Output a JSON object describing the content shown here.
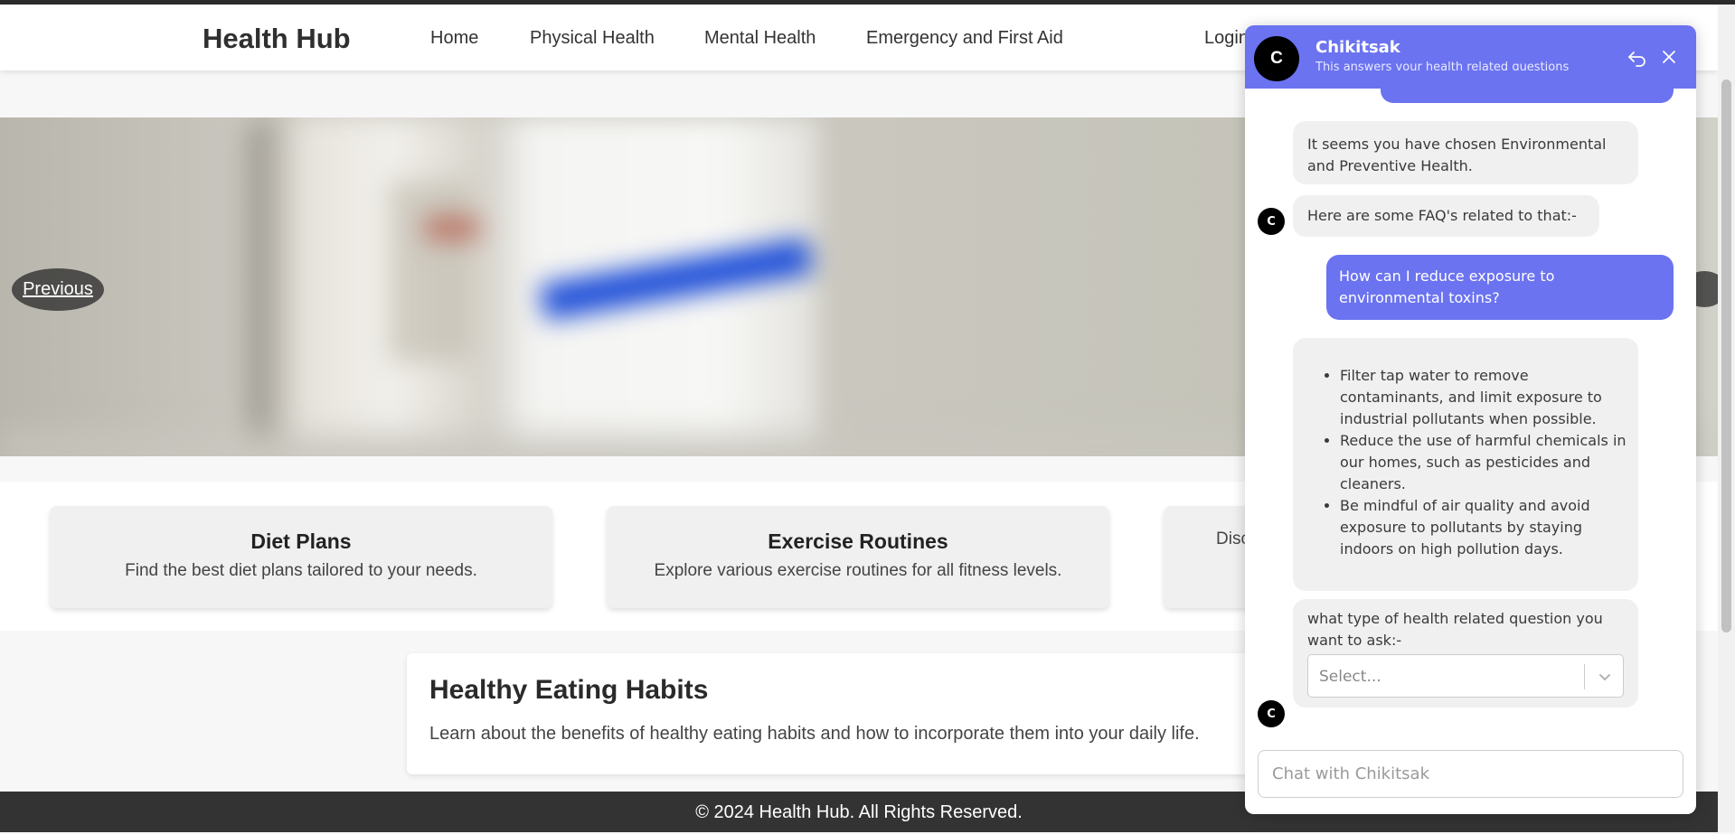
{
  "app": {
    "brand": "Health Hub"
  },
  "nav": {
    "items": [
      {
        "label": "Home"
      },
      {
        "label": "Physical Health"
      },
      {
        "label": "Mental Health"
      },
      {
        "label": "Emergency and First Aid"
      },
      {
        "label": "Login"
      }
    ]
  },
  "carousel": {
    "prev_label": "Previous"
  },
  "cards": [
    {
      "title": "Diet Plans",
      "description": "Find the best diet plans tailored to your needs."
    },
    {
      "title": "Exercise Routines",
      "description": "Explore various exercise routines for all fitness levels."
    },
    {
      "title": "",
      "description": "Disc"
    }
  ],
  "article": {
    "title": "Healthy Eating Habits",
    "body": "Learn about the benefits of healthy eating habits and how to incorporate them into your daily life."
  },
  "footer": {
    "text": "© 2024 Health Hub. All Rights Reserved."
  },
  "chat": {
    "avatar_letter": "C",
    "title": "Chikitsak",
    "subtitle": "This answers your health related questions",
    "header_color": "#6b73f0",
    "messages": [
      {
        "from": "bot",
        "text": "It seems you have chosen Environmental and Preventive Health."
      },
      {
        "from": "bot",
        "text": "Here are some FAQ's related to that:-"
      },
      {
        "from": "user",
        "text": "How can I reduce exposure to environmental toxins?"
      },
      {
        "from": "bot",
        "list": [
          "Filter tap water to remove contaminants, and limit exposure to industrial pollutants when possible.",
          "Reduce the use of harmful chemicals in our homes, such as pesticides and cleaners.",
          "Be mindful of air quality and avoid exposure to pollutants by staying indoors on high pollution days."
        ]
      },
      {
        "from": "bot",
        "text": "what type of health related question you want to ask:-"
      }
    ],
    "select": {
      "placeholder": "Select..."
    },
    "input": {
      "placeholder": "Chat with Chikitsak"
    }
  },
  "icons": {
    "restart": "restart-icon",
    "close": "close-icon",
    "chevron": "chevron-down-icon"
  }
}
